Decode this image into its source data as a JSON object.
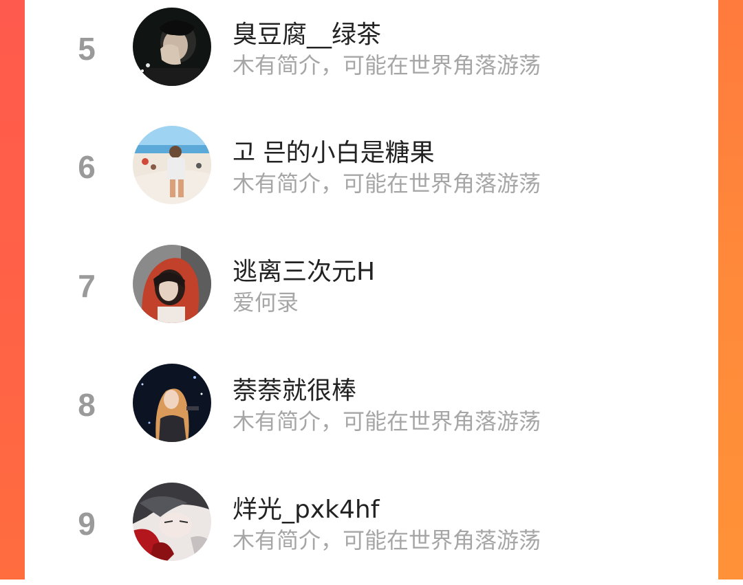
{
  "colors": {
    "edge_left": "#ff5a4e",
    "edge_right": "#ff8a3a",
    "rank_gray": "#9a9a9a",
    "name_text": "#222222",
    "bio_text": "#a6a6a6"
  },
  "ranking": {
    "rows": [
      {
        "rank": "5",
        "name": "臭豆腐__绿茶",
        "bio": "木有简介，可能在世界角落游荡",
        "avatar": "dark-portrait-avatar"
      },
      {
        "rank": "6",
        "name": "고 믄的小白是糖果",
        "bio": "木有简介，可能在世界角落游荡",
        "avatar": "beach-photo-avatar"
      },
      {
        "rank": "7",
        "name": "逃离三次元H",
        "bio": "爱何录",
        "avatar": "red-hood-portrait-avatar"
      },
      {
        "rank": "8",
        "name": "萘萘就很棒",
        "bio": "木有简介，可能在世界角落游荡",
        "avatar": "night-stage-portrait-avatar"
      },
      {
        "rank": "9",
        "name": "烊光_pxk4hf",
        "bio": "木有简介，可能在世界角落游荡",
        "avatar": "illustrated-character-avatar"
      }
    ]
  }
}
